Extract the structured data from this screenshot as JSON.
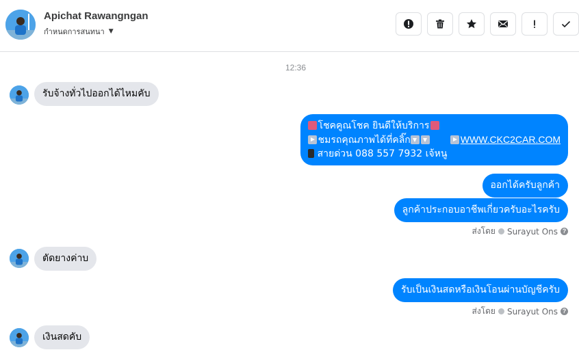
{
  "header": {
    "contact_name": "Apichat Rawangngan",
    "contact_sub": "กำหนดการสนทนา",
    "actions": [
      {
        "icon": "alert-circle-icon",
        "label": "!"
      },
      {
        "icon": "trash-icon"
      },
      {
        "icon": "star-icon"
      },
      {
        "icon": "mail-icon"
      },
      {
        "icon": "exclamation-icon",
        "label": "!"
      },
      {
        "icon": "check-icon"
      }
    ]
  },
  "timestamp": "12:36",
  "messages": [
    {
      "text": "รับจ้างทั่วไปออกได้ไหมคับ"
    },
    {
      "line1": "โชคคูณโชค ยินดีให้บริการ",
      "line2": "ชมรถคุณภาพได้ที่คลิ๊ก",
      "line2_link": "WWW.CKC2CAR.COM",
      "line3": "สายด่วน 088 557 7932 เจ้หนู"
    },
    {
      "text": "ออกได้ครับลูกค้า"
    },
    {
      "text": "ลูกค้าประกอบอาชีพเกี่ยวครับอะไรครับ"
    },
    {
      "text": "ตัดยางค่าบ"
    },
    {
      "text": "รับเป็นเงินสดหรือเงินโอนผ่านบัญชีครับ"
    },
    {
      "text": "เงินสดคับ"
    }
  ],
  "sent_by": {
    "prefix": "ส่งโดย",
    "name": "Surayut Ons",
    "help": "?"
  },
  "colors": {
    "outgoing": "#0084ff",
    "incoming": "#e4e6eb",
    "border": "#dddfe2"
  }
}
